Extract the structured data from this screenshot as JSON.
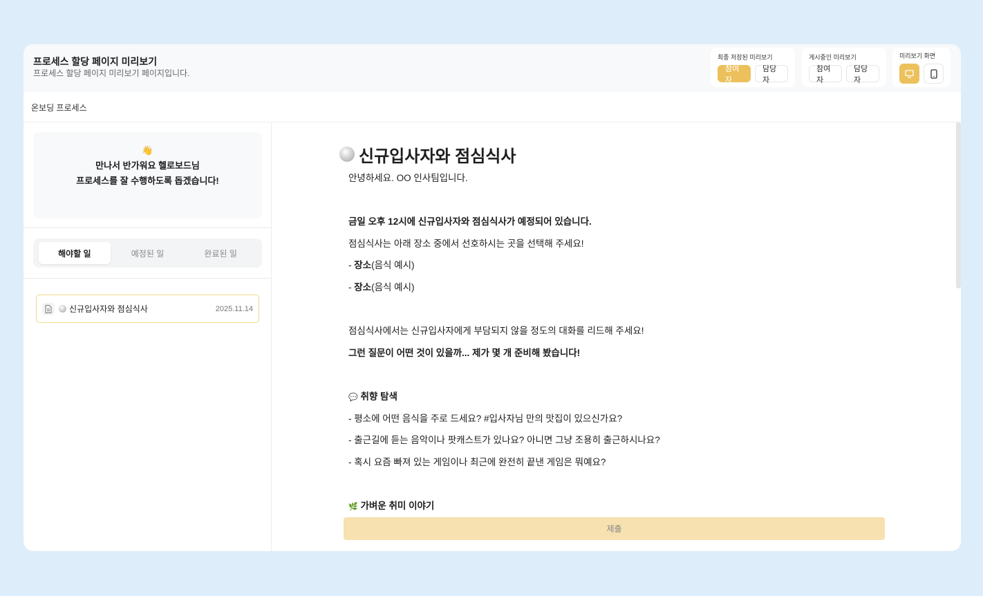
{
  "header": {
    "title": "프로세스 할당 페이지 미리보기",
    "subtitle": "프로세스 할당 페이지 미리보기 페이지입니다.",
    "saved_preview": {
      "label": "최종 저장된 미리보기",
      "participant": "참여자",
      "manager": "담당자"
    },
    "published_preview": {
      "label": "게시중인 미리보기",
      "participant": "참여자",
      "manager": "담당자"
    },
    "preview_screen": {
      "label": "미리보기 화면",
      "desktop_icon": "monitor-icon",
      "mobile_icon": "mobile-icon"
    }
  },
  "breadcrumb": "온보딩 프로세스",
  "sidebar": {
    "welcome_emoji": "👋",
    "welcome_line1": "만나서 반가워요 헬로보드님",
    "welcome_line2": "프로세스를 잘 수행하도록 돕겠습니다!",
    "tabs": [
      "해야할 일",
      "예정된 일",
      "완료된 일"
    ],
    "items": [
      {
        "title": "신규입사자와 점심식사",
        "date": "2025.11.14"
      }
    ]
  },
  "content": {
    "title": "신규입사자와 점심식사",
    "greeting": "안녕하세요. OO 인사팀입니다.",
    "announce": "금일 오후 12시에 신규입사자와 점심식사가 예정되어 있습니다.",
    "choose": "점심식사는 아래 장소 중에서 선호하시는 곳을 선택해 주세요!",
    "places": [
      {
        "name": "장소",
        "note": "(음식 예시)"
      },
      {
        "name": "장소",
        "note": "(음식 예시)"
      }
    ],
    "lead": "점심식사에서는 신규입사자에게 부담되지 않을 정도의 대화를 리드해 주세요!",
    "prepared": "그런 질문이 어떤 것이 있을까... 제가 몇 개 준비해 봤습니다!",
    "section1": {
      "emoji": "💬",
      "title": "취향 탐색",
      "questions": [
        "- 평소에 어떤 음식을 주로 드세요? #입사자님 만의 맛집이 있으신가요?",
        "- 출근길에 듣는 음악이나 팟캐스트가 있나요? 아니면 그냥 조용히 출근하시나요?",
        "- 혹시 요즘 빠져 있는 게임이나 최근에 완전히 끝낸 게임은 뭐예요?"
      ]
    },
    "section2": {
      "emoji": "🌿",
      "title": "가벼운 취미 이야기"
    },
    "submit": "제출"
  },
  "colors": {
    "accent": "#ecc15c",
    "submit_bg": "#f7e1b0",
    "background": "#deedfa"
  }
}
